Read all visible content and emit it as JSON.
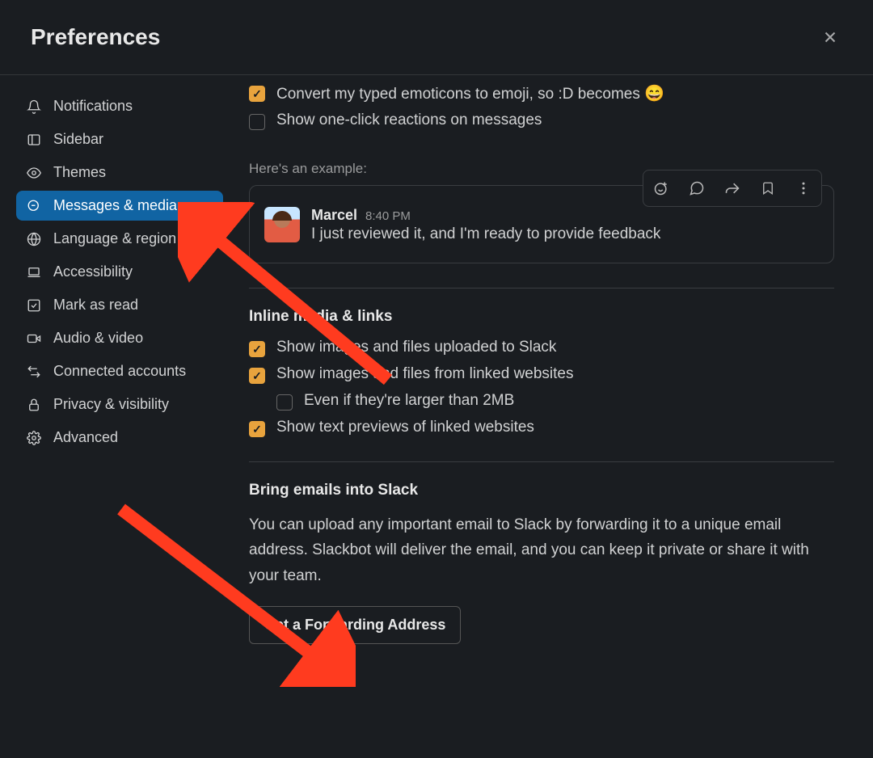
{
  "header": {
    "title": "Preferences"
  },
  "sidebar": {
    "items": [
      {
        "label": "Notifications",
        "icon": "bell"
      },
      {
        "label": "Sidebar",
        "icon": "sidebar"
      },
      {
        "label": "Themes",
        "icon": "eye"
      },
      {
        "label": "Messages & media",
        "icon": "search-msg",
        "active": true
      },
      {
        "label": "Language & region",
        "icon": "globe"
      },
      {
        "label": "Accessibility",
        "icon": "laptop"
      },
      {
        "label": "Mark as read",
        "icon": "check-square"
      },
      {
        "label": "Audio & video",
        "icon": "video"
      },
      {
        "label": "Connected accounts",
        "icon": "swap"
      },
      {
        "label": "Privacy & visibility",
        "icon": "lock"
      },
      {
        "label": "Advanced",
        "icon": "gear"
      }
    ]
  },
  "top_options": {
    "convert_emoticons": {
      "checked": true,
      "label": "Convert my typed emoticons to emoji, so :D becomes ",
      "emoji": "😄"
    },
    "one_click_reactions": {
      "checked": false,
      "label": "Show one-click reactions on messages"
    }
  },
  "example": {
    "intro": "Here's an example:",
    "name": "Marcel",
    "time": "8:40 PM",
    "text": "I just reviewed it, and I'm ready to provide feedback"
  },
  "inline": {
    "title": "Inline media & links",
    "options": {
      "uploaded": {
        "checked": true,
        "label": "Show images and files uploaded to Slack"
      },
      "linked": {
        "checked": true,
        "label": "Show images and files from linked websites"
      },
      "larger": {
        "checked": false,
        "label": "Even if they're larger than 2MB"
      },
      "previews": {
        "checked": true,
        "label": "Show text previews of linked websites"
      }
    }
  },
  "emails": {
    "title": "Bring emails into Slack",
    "desc": "You can upload any important email to Slack by forwarding it to a unique email address. Slackbot will deliver the email, and you can keep it private or share it with your team.",
    "button": "Get a Forwarding Address"
  },
  "annotations": {
    "color": "#ff3b1f"
  }
}
